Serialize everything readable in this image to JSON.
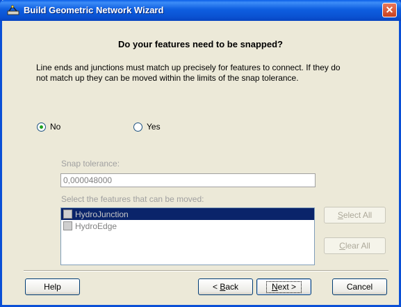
{
  "window": {
    "title": "Build Geometric Network Wizard",
    "close_symbol": "✕"
  },
  "heading": "Do your features need to be snapped?",
  "description": "Line ends and junctions must match up precisely for features to connect.  If they do not match up they can be moved within the limits of the snap tolerance.",
  "options": {
    "no_label": "No",
    "yes_label": "Yes",
    "selected": "No"
  },
  "snap_tolerance": {
    "label": "Snap tolerance:",
    "value": "0,000048000"
  },
  "features": {
    "label": "Select the features that can be moved:",
    "items": [
      {
        "label": "HydroJunction",
        "selected": true,
        "checked": false
      },
      {
        "label": "HydroEdge",
        "selected": false,
        "checked": false
      }
    ]
  },
  "side_buttons": {
    "select_all_mnemonic": "S",
    "select_all_rest": "elect All",
    "clear_all_mnemonic": "C",
    "clear_all_rest": "lear All"
  },
  "footer_buttons": {
    "help": "Help",
    "back_prefix": "< ",
    "back_mnemonic": "B",
    "back_rest": "ack",
    "next_mnemonic": "N",
    "next_rest": "ext >",
    "cancel": "Cancel"
  },
  "colors": {
    "titlebar": "#0a52d2",
    "dialog_bg": "#ece9d8",
    "selection": "#0a246a"
  }
}
